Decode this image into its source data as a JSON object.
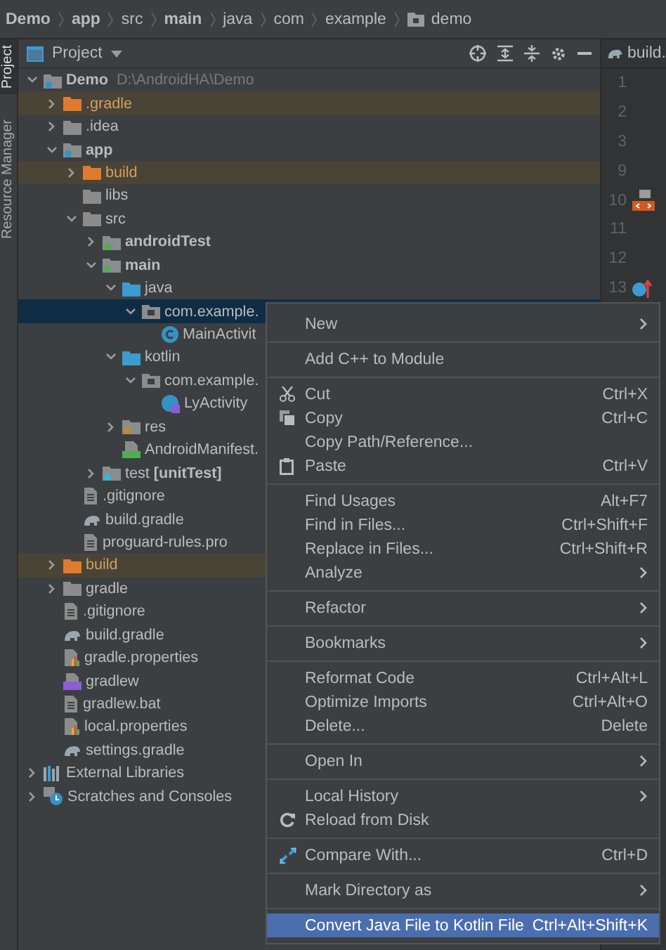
{
  "breadcrumbs": [
    {
      "label": "Demo",
      "bold": true
    },
    {
      "label": "app",
      "bold": true
    },
    {
      "label": "src",
      "bold": false
    },
    {
      "label": "main",
      "bold": true
    },
    {
      "label": "java",
      "bold": false
    },
    {
      "label": "com",
      "bold": false
    },
    {
      "label": "example",
      "bold": false
    },
    {
      "label": "demo",
      "bold": false,
      "kind": "package"
    }
  ],
  "side_tabs": [
    {
      "label": "Project",
      "selected": true
    },
    {
      "label": "Resource Manager",
      "selected": false
    }
  ],
  "panel": {
    "title": "Project"
  },
  "editor_tab": {
    "label": "build."
  },
  "gutter": {
    "lines": [
      "1",
      "2",
      "3",
      "9",
      "10",
      "11",
      "12",
      "13"
    ]
  },
  "tree": [
    {
      "label": "Demo",
      "path": "D:\\AndroidHA\\Demo",
      "kind": "module",
      "bold": true,
      "expanded": true,
      "excluded": false,
      "selected": false,
      "children": [
        {
          "label": ".gradle",
          "kind": "folder-excluded",
          "expanded": false,
          "excluded": true,
          "selected": false
        },
        {
          "label": ".idea",
          "kind": "folder",
          "expanded": false,
          "excluded": false,
          "selected": false
        },
        {
          "label": "app",
          "kind": "module",
          "bold": true,
          "expanded": true,
          "excluded": false,
          "selected": false,
          "children": [
            {
              "label": "build",
              "kind": "folder-excluded",
              "expanded": false,
              "excluded": true,
              "selected": false
            },
            {
              "label": "libs",
              "kind": "folder",
              "excluded": false,
              "selected": false
            },
            {
              "label": "src",
              "kind": "folder",
              "expanded": true,
              "excluded": false,
              "selected": false,
              "children": [
                {
                  "label": "androidTest",
                  "kind": "source-root",
                  "bold": true,
                  "expanded": false,
                  "excluded": false,
                  "selected": false
                },
                {
                  "label": "main",
                  "kind": "source-root",
                  "bold": true,
                  "expanded": true,
                  "excluded": false,
                  "selected": false,
                  "children": [
                    {
                      "label": "java",
                      "kind": "java-folder",
                      "expanded": true,
                      "excluded": false,
                      "selected": false,
                      "children": [
                        {
                          "label": "com.example.",
                          "kind": "package",
                          "expanded": true,
                          "excluded": false,
                          "selected": true,
                          "children": [
                            {
                              "label": "MainActivit",
                              "kind": "class",
                              "excluded": false,
                              "selected": false
                            }
                          ]
                        }
                      ]
                    },
                    {
                      "label": "kotlin",
                      "kind": "java-folder",
                      "expanded": true,
                      "excluded": false,
                      "selected": false,
                      "children": [
                        {
                          "label": "com.example.",
                          "kind": "package",
                          "expanded": true,
                          "excluded": false,
                          "selected": false,
                          "children": [
                            {
                              "label": "LyActivity",
                              "kind": "kotlin-class",
                              "excluded": false,
                              "selected": false
                            }
                          ]
                        }
                      ]
                    },
                    {
                      "label": "res",
                      "kind": "resources",
                      "expanded": false,
                      "excluded": false,
                      "selected": false
                    },
                    {
                      "label": "AndroidManifest.",
                      "kind": "manifest",
                      "excluded": false,
                      "selected": false
                    }
                  ]
                },
                {
                  "label": "test **[unitTest]**",
                  "kind": "test-root",
                  "expanded": false,
                  "excluded": false,
                  "selected": false
                }
              ]
            },
            {
              "label": ".gitignore",
              "kind": "text-file",
              "excluded": false,
              "selected": false
            },
            {
              "label": "build.gradle",
              "kind": "gradle",
              "excluded": false,
              "selected": false
            },
            {
              "label": "proguard-rules.pro",
              "kind": "text-file",
              "excluded": false,
              "selected": false
            }
          ]
        },
        {
          "label": "build",
          "kind": "folder-excluded",
          "expanded": false,
          "excluded": true,
          "selected": false
        },
        {
          "label": "gradle",
          "kind": "folder",
          "expanded": false,
          "excluded": false,
          "selected": false
        },
        {
          "label": ".gitignore",
          "kind": "text-file",
          "excluded": false,
          "selected": false
        },
        {
          "label": "build.gradle",
          "kind": "gradle",
          "excluded": false,
          "selected": false
        },
        {
          "label": "gradle.properties",
          "kind": "properties",
          "excluded": false,
          "selected": false
        },
        {
          "label": "gradlew",
          "kind": "shell",
          "excluded": false,
          "selected": false
        },
        {
          "label": "gradlew.bat",
          "kind": "text-file",
          "excluded": false,
          "selected": false
        },
        {
          "label": "local.properties",
          "kind": "properties",
          "excluded": false,
          "selected": false
        },
        {
          "label": "settings.gradle",
          "kind": "gradle",
          "excluded": false,
          "selected": false
        }
      ]
    },
    {
      "label": "External Libraries",
      "kind": "libraries",
      "expanded": false,
      "excluded": false,
      "selected": false
    },
    {
      "label": "Scratches and Consoles",
      "kind": "scratches",
      "expanded": false,
      "excluded": false,
      "selected": false
    }
  ],
  "context_menu": [
    {
      "kind": "item",
      "label": "New",
      "submenu": true,
      "selected": false
    },
    {
      "kind": "separator"
    },
    {
      "kind": "item",
      "label": "Add C++ to Module",
      "selected": false
    },
    {
      "kind": "separator"
    },
    {
      "kind": "item",
      "label": "Cut",
      "shortcut": "Ctrl+X",
      "selected": false
    },
    {
      "kind": "item",
      "label": "Copy",
      "shortcut": "Ctrl+C",
      "selected": false
    },
    {
      "kind": "item",
      "label": "Copy Path/Reference...",
      "selected": false
    },
    {
      "kind": "item",
      "label": "Paste",
      "shortcut": "Ctrl+V",
      "selected": false
    },
    {
      "kind": "separator"
    },
    {
      "kind": "item",
      "label": "Find Usages",
      "shortcut": "Alt+F7",
      "selected": false
    },
    {
      "kind": "item",
      "label": "Find in Files...",
      "shortcut": "Ctrl+Shift+F",
      "selected": false
    },
    {
      "kind": "item",
      "label": "Replace in Files...",
      "shortcut": "Ctrl+Shift+R",
      "selected": false
    },
    {
      "kind": "item",
      "label": "Analyze",
      "submenu": true,
      "selected": false
    },
    {
      "kind": "separator"
    },
    {
      "kind": "item",
      "label": "Refactor",
      "submenu": true,
      "selected": false
    },
    {
      "kind": "separator"
    },
    {
      "kind": "item",
      "label": "Bookmarks",
      "submenu": true,
      "selected": false
    },
    {
      "kind": "separator"
    },
    {
      "kind": "item",
      "label": "Reformat Code",
      "shortcut": "Ctrl+Alt+L",
      "selected": false
    },
    {
      "kind": "item",
      "label": "Optimize Imports",
      "shortcut": "Ctrl+Alt+O",
      "selected": false
    },
    {
      "kind": "item",
      "label": "Delete...",
      "shortcut": "Delete",
      "selected": false
    },
    {
      "kind": "separator"
    },
    {
      "kind": "item",
      "label": "Open In",
      "submenu": true,
      "selected": false
    },
    {
      "kind": "separator"
    },
    {
      "kind": "item",
      "label": "Local History",
      "submenu": true,
      "selected": false
    },
    {
      "kind": "item",
      "label": "Reload from Disk",
      "selected": false
    },
    {
      "kind": "separator"
    },
    {
      "kind": "item",
      "label": "Compare With...",
      "shortcut": "Ctrl+D",
      "selected": false
    },
    {
      "kind": "separator"
    },
    {
      "kind": "item",
      "label": "Mark Directory as",
      "submenu": true,
      "selected": false
    },
    {
      "kind": "separator"
    },
    {
      "kind": "item",
      "label": "Convert Java File to Kotlin File",
      "shortcut": "Ctrl+Alt+Shift+K",
      "selected": true
    }
  ]
}
